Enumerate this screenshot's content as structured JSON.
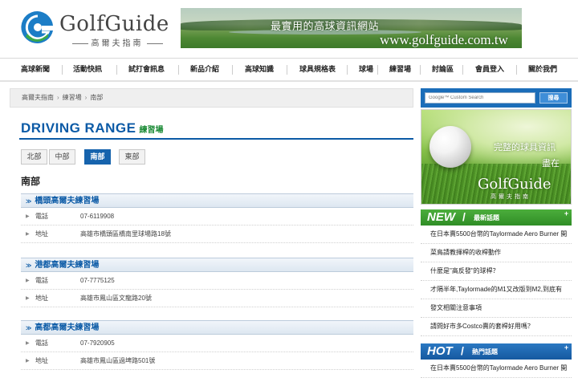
{
  "brand": {
    "logo_name": "GolfGuide",
    "logo_sub": "高爾夫指南",
    "banner_tagline": "最實用的高球資訊網站",
    "banner_url": "www.golfguide.com.tw"
  },
  "nav": {
    "items": [
      {
        "label": "高球新聞"
      },
      {
        "label": "活動快訊"
      },
      {
        "label": "試打會訊息"
      },
      {
        "label": "新品介紹"
      },
      {
        "label": "高球知識"
      },
      {
        "label": "球具規格表"
      },
      {
        "label": "球場"
      },
      {
        "label": "練習場"
      },
      {
        "label": "討論區"
      },
      {
        "label": "會員登入"
      },
      {
        "label": "關於我們"
      }
    ]
  },
  "breadcrumb": {
    "items": [
      "高爾夫指南",
      "練習場",
      "南部"
    ]
  },
  "page": {
    "title_en": "DRIVING RANGE",
    "title_zh": "練習場",
    "region_heading": "南部"
  },
  "tabs": {
    "items": [
      {
        "label": "北部",
        "active": false
      },
      {
        "label": "中部",
        "active": false
      },
      {
        "label": "南部",
        "active": true
      },
      {
        "label": "東部",
        "active": false
      }
    ]
  },
  "ranges": [
    {
      "arrow": "≫",
      "name": "橋頭高爾夫練習場",
      "phone_label": "電話",
      "phone": "07-6119908",
      "address_label": "地址",
      "address": "高雄市橋頭區橋南里球場路18號"
    },
    {
      "arrow": "≫",
      "name": "港都高爾夫練習場",
      "phone_label": "電話",
      "phone": "07-7775125",
      "address_label": "地址",
      "address": "高雄市鳳山區文龍路20號"
    },
    {
      "arrow": "≫",
      "name": "高都高爾夫練習場",
      "phone_label": "電話",
      "phone": "07-7920905",
      "address_label": "地址",
      "address": "高雄市鳳山區過埤路501號"
    }
  ],
  "sidebar": {
    "search": {
      "placeholder": "Google™ Custom Search",
      "button": "搜尋"
    },
    "promo": {
      "line1": "完整的球具資訊",
      "line2": "盡在",
      "logo": "GolfGuide",
      "sub": "高爾夫指南"
    },
    "new_box": {
      "big": "NEW",
      "small": "最新話題",
      "items": [
        "在日本賣5500台幣的Taylormade Aero Burner 開",
        "菜鳥請教揮桿的收桿動作",
        "什麼是\"高反發\"的球桿？",
        "才隔半年,Taylormade的M1又改版到M2,到底有",
        "發文相關注意事項",
        "請問好市多Costco賣的套桿好用嗎？"
      ]
    },
    "hot_box": {
      "big": "HOT",
      "small": "熱門話題",
      "items": [
        "在日本賣5500台幣的Taylormade Aero Burner 開"
      ]
    }
  },
  "colors": {
    "primary_blue": "#0b5aa6",
    "accent_green": "#2f8d26",
    "tab_active": "#1663ad"
  }
}
